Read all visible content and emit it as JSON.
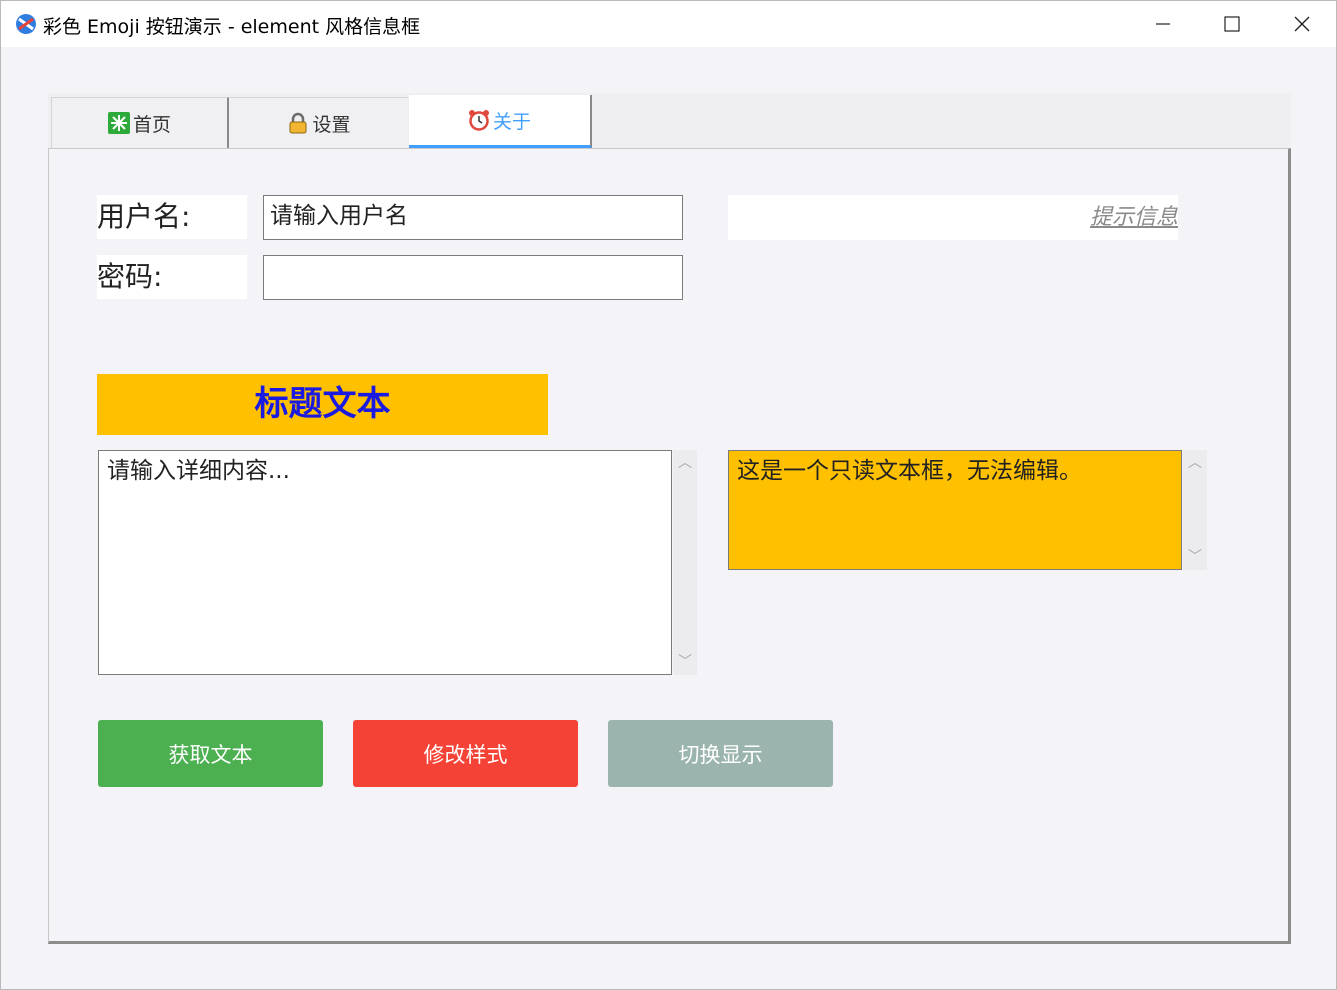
{
  "window": {
    "title": "彩色 Emoji 按钮演示 - element 风格信息框"
  },
  "tabs": [
    {
      "label": "首页",
      "icon": "sparkle-icon"
    },
    {
      "label": "设置",
      "icon": "lock-icon"
    },
    {
      "label": "关于",
      "icon": "alarm-clock-icon",
      "active": true
    }
  ],
  "form": {
    "username_label": "用户名:",
    "username_value": "请输入用户名",
    "password_label": "密码:",
    "password_value": "",
    "hint_text": "提示信息"
  },
  "title_block": {
    "text": "标题文本"
  },
  "details": {
    "text": "请输入详细内容..."
  },
  "readonly": {
    "text": "这是一个只读文本框，无法编辑。"
  },
  "buttons": {
    "get_text": "获取文本",
    "modify_style": "修改样式",
    "toggle_display": "切换显示"
  },
  "colors": {
    "tab_active": "#409eff",
    "title_bg": "#ffc000",
    "title_fg": "#1a1ae0",
    "btn_green": "#4caf50",
    "btn_red": "#f44336",
    "btn_gray": "#9bb5ae"
  }
}
